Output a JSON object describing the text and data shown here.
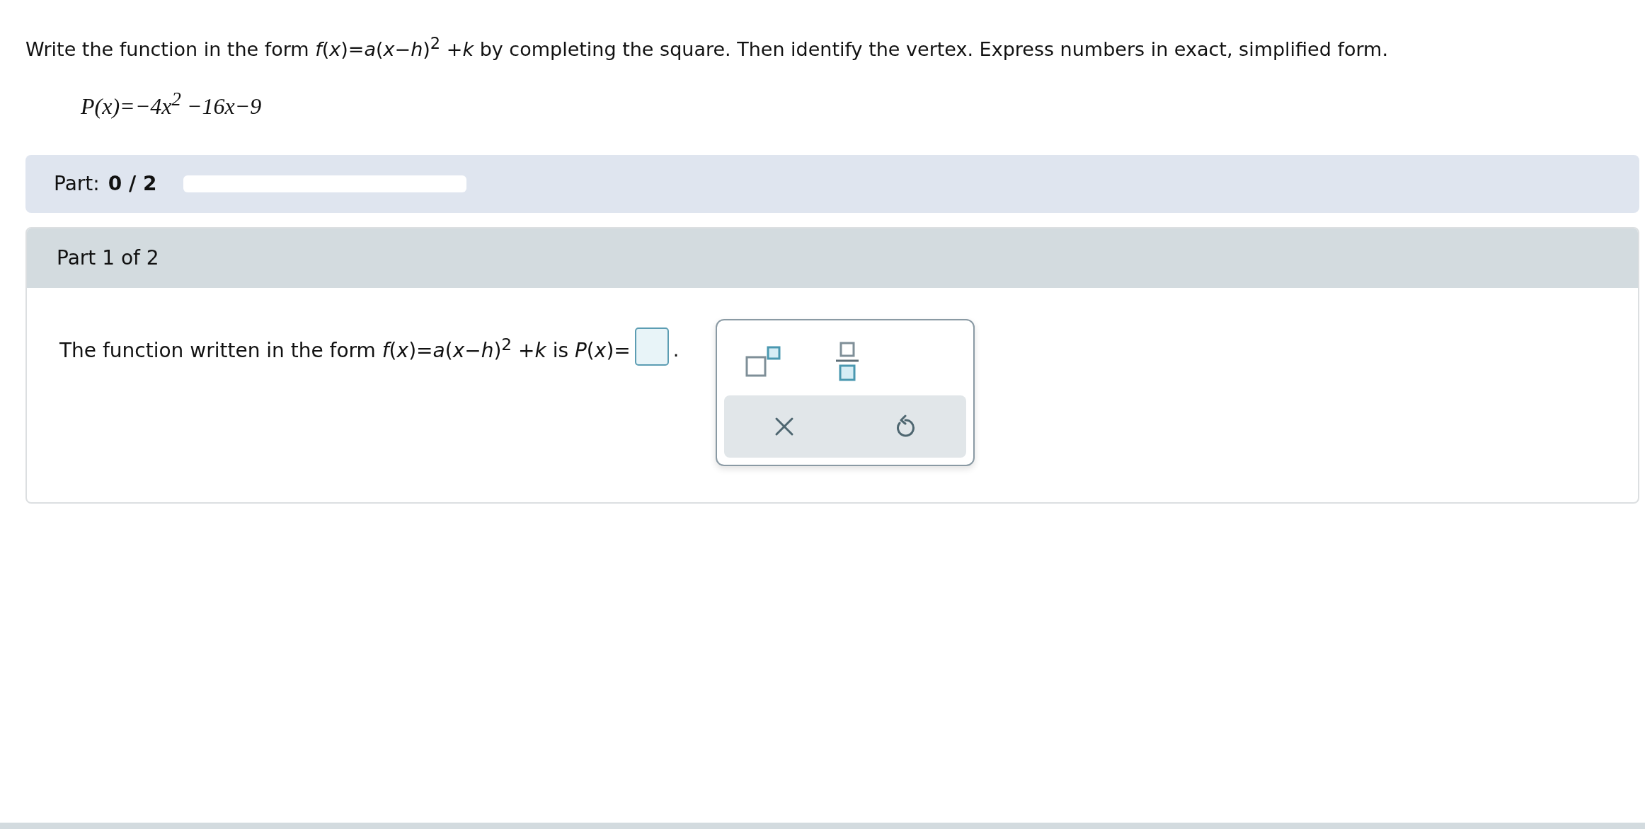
{
  "instruction": "Write the function in the form *f*(*x*)=*a*(*x*−*h*)$^{2}$ +*k* by completing the square. Then identify the vertex. Express numbers in exact, simplified form.",
  "given_function": "P(x)=−4x$^{2}$ −16x−9",
  "progress": {
    "label": "Part:",
    "value": "0 / 2",
    "level": 0
  },
  "part": {
    "title": "Part 1 of 2",
    "prompt": "The function written in the form *f*(*x*)=*a*(*x*−*h*)$^{2}$ +*k* is *P*(*x*)=",
    "after_answer": "."
  }
}
